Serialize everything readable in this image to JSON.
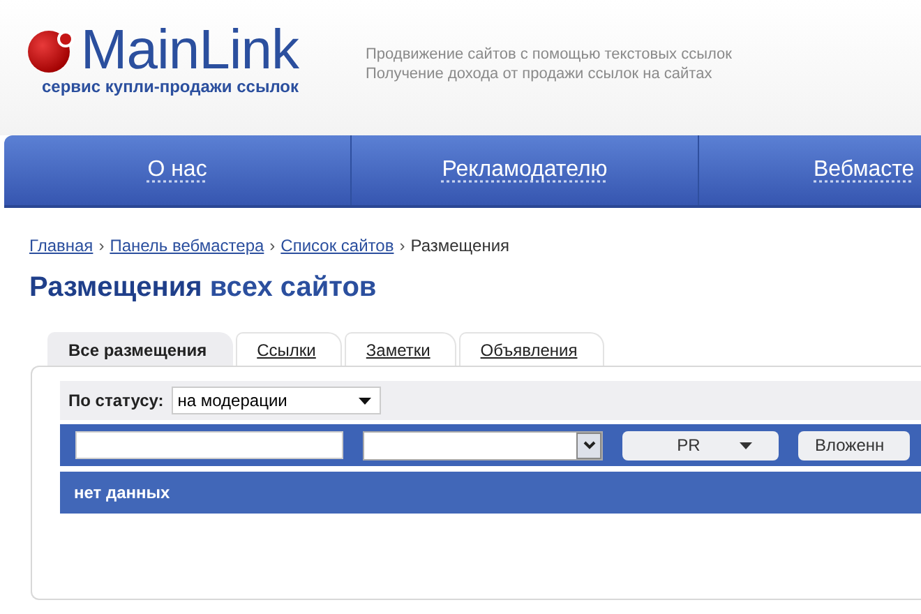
{
  "logo": {
    "name": "MainLink",
    "tagline": "сервис купли-продажи ссылок"
  },
  "slogans": [
    "Продвижение сайтов с помощью текстовых ссылок",
    "Получение дохода от продажи ссылок на сайтах"
  ],
  "nav": [
    {
      "label": "О нас"
    },
    {
      "label": "Рекламодателю"
    },
    {
      "label": "Вебмасте"
    }
  ],
  "breadcrumbs": [
    {
      "label": "Главная",
      "kind": "link"
    },
    {
      "label": "Панель вебмастера",
      "kind": "link"
    },
    {
      "label": "Список сайтов",
      "kind": "link"
    },
    {
      "label": "Размещения",
      "kind": "current"
    }
  ],
  "breadcrumb_separator": "›",
  "title": {
    "first": "Размещения",
    "rest": "всех сайтов"
  },
  "tabs": [
    {
      "label": "Все размещения",
      "selected": true
    },
    {
      "label": "Ссылки",
      "selected": false
    },
    {
      "label": "Заметки",
      "selected": false
    },
    {
      "label": "Объявления",
      "selected": false
    }
  ],
  "status_filter": {
    "label": "По статусу:",
    "value": "на модерации"
  },
  "filters": [
    {
      "kind": "text"
    },
    {
      "kind": "select"
    },
    {
      "kind": "button",
      "label": "PR"
    },
    {
      "kind": "button",
      "label": "Вложенн"
    }
  ],
  "empty_message": "нет данных"
}
